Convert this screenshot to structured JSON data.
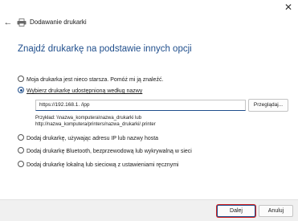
{
  "window": {
    "title": "Dodawanie drukarki",
    "close_glyph": "✕",
    "back_glyph": "←"
  },
  "page": {
    "heading": "Znajdź drukarkę na podstawie innych opcji"
  },
  "options": [
    {
      "label": "Moja drukarka jest nieco starsza. Pomóż mi ją znaleźć.",
      "checked": false
    },
    {
      "label": "Wybierz drukarkę udostępnioną według nazwy",
      "checked": true
    },
    {
      "label": "Dodaj drukarkę, używając adresu IP lub nazwy hosta",
      "checked": false
    },
    {
      "label": "Dodaj drukarkę Bluetooth, bezprzewodową lub wykrywalną w sieci",
      "checked": false
    },
    {
      "label": "Dodaj drukarkę lokalną lub sieciową z ustawieniami ręcznymi",
      "checked": false
    }
  ],
  "shared_printer": {
    "value": "https://192.168.1.  /ipp",
    "browse_label": "Przeglądaj...",
    "example_line1": "Przykład: \\\\nazwa_komputera\\nazwa_drukarki lub",
    "example_line2": "http://nazwa_komputera/printers/nazwa_drukarki/.printer"
  },
  "footer": {
    "next_label": "Dalej",
    "cancel_label": "Anuluj"
  },
  "colors": {
    "accent": "#1f4e8c",
    "highlight": "#d42020"
  },
  "icons": {
    "printer": "printer-icon",
    "back": "arrow-left-icon",
    "close": "close-icon"
  }
}
